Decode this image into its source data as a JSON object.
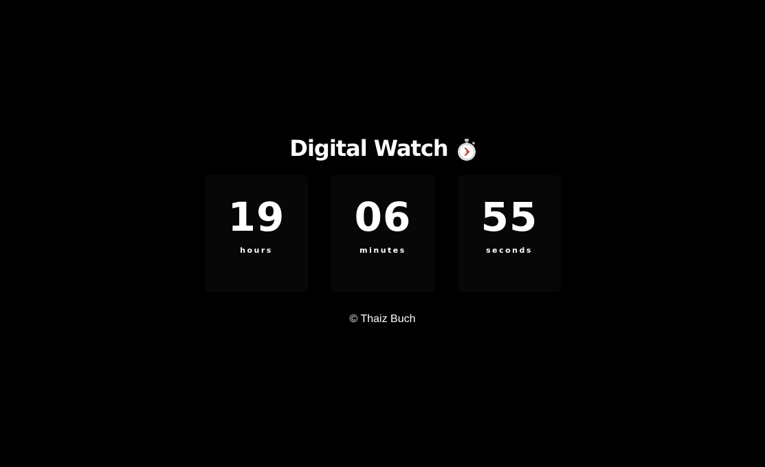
{
  "header": {
    "title": "Digital Watch",
    "icon": "stopwatch-icon"
  },
  "clock": {
    "hours": {
      "value": "19",
      "label": "hours"
    },
    "minutes": {
      "value": "06",
      "label": "minutes"
    },
    "seconds": {
      "value": "55",
      "label": "seconds"
    }
  },
  "footer": {
    "text": "© Thaiz Buch"
  },
  "colors": {
    "background": "#000000",
    "card": "#070707",
    "text": "#ffffff",
    "icon_hand": "#d32f2f"
  }
}
